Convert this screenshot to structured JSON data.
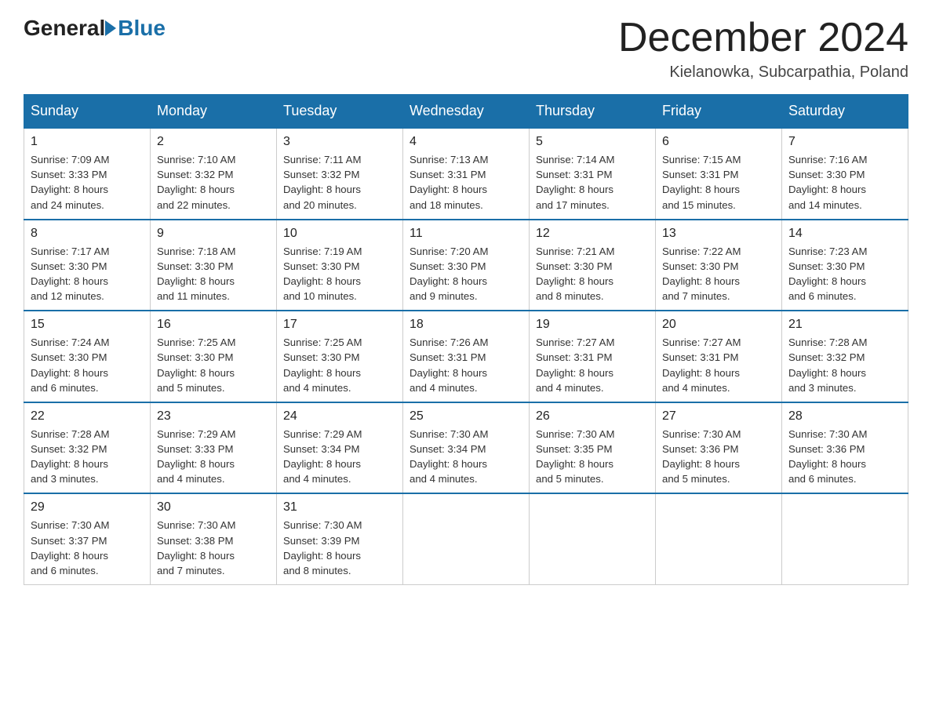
{
  "logo": {
    "general": "General",
    "blue": "Blue"
  },
  "title": "December 2024",
  "location": "Kielanowka, Subcarpathia, Poland",
  "days_of_week": [
    "Sunday",
    "Monday",
    "Tuesday",
    "Wednesday",
    "Thursday",
    "Friday",
    "Saturday"
  ],
  "weeks": [
    [
      {
        "day": "1",
        "info": "Sunrise: 7:09 AM\nSunset: 3:33 PM\nDaylight: 8 hours\nand 24 minutes."
      },
      {
        "day": "2",
        "info": "Sunrise: 7:10 AM\nSunset: 3:32 PM\nDaylight: 8 hours\nand 22 minutes."
      },
      {
        "day": "3",
        "info": "Sunrise: 7:11 AM\nSunset: 3:32 PM\nDaylight: 8 hours\nand 20 minutes."
      },
      {
        "day": "4",
        "info": "Sunrise: 7:13 AM\nSunset: 3:31 PM\nDaylight: 8 hours\nand 18 minutes."
      },
      {
        "day": "5",
        "info": "Sunrise: 7:14 AM\nSunset: 3:31 PM\nDaylight: 8 hours\nand 17 minutes."
      },
      {
        "day": "6",
        "info": "Sunrise: 7:15 AM\nSunset: 3:31 PM\nDaylight: 8 hours\nand 15 minutes."
      },
      {
        "day": "7",
        "info": "Sunrise: 7:16 AM\nSunset: 3:30 PM\nDaylight: 8 hours\nand 14 minutes."
      }
    ],
    [
      {
        "day": "8",
        "info": "Sunrise: 7:17 AM\nSunset: 3:30 PM\nDaylight: 8 hours\nand 12 minutes."
      },
      {
        "day": "9",
        "info": "Sunrise: 7:18 AM\nSunset: 3:30 PM\nDaylight: 8 hours\nand 11 minutes."
      },
      {
        "day": "10",
        "info": "Sunrise: 7:19 AM\nSunset: 3:30 PM\nDaylight: 8 hours\nand 10 minutes."
      },
      {
        "day": "11",
        "info": "Sunrise: 7:20 AM\nSunset: 3:30 PM\nDaylight: 8 hours\nand 9 minutes."
      },
      {
        "day": "12",
        "info": "Sunrise: 7:21 AM\nSunset: 3:30 PM\nDaylight: 8 hours\nand 8 minutes."
      },
      {
        "day": "13",
        "info": "Sunrise: 7:22 AM\nSunset: 3:30 PM\nDaylight: 8 hours\nand 7 minutes."
      },
      {
        "day": "14",
        "info": "Sunrise: 7:23 AM\nSunset: 3:30 PM\nDaylight: 8 hours\nand 6 minutes."
      }
    ],
    [
      {
        "day": "15",
        "info": "Sunrise: 7:24 AM\nSunset: 3:30 PM\nDaylight: 8 hours\nand 6 minutes."
      },
      {
        "day": "16",
        "info": "Sunrise: 7:25 AM\nSunset: 3:30 PM\nDaylight: 8 hours\nand 5 minutes."
      },
      {
        "day": "17",
        "info": "Sunrise: 7:25 AM\nSunset: 3:30 PM\nDaylight: 8 hours\nand 4 minutes."
      },
      {
        "day": "18",
        "info": "Sunrise: 7:26 AM\nSunset: 3:31 PM\nDaylight: 8 hours\nand 4 minutes."
      },
      {
        "day": "19",
        "info": "Sunrise: 7:27 AM\nSunset: 3:31 PM\nDaylight: 8 hours\nand 4 minutes."
      },
      {
        "day": "20",
        "info": "Sunrise: 7:27 AM\nSunset: 3:31 PM\nDaylight: 8 hours\nand 4 minutes."
      },
      {
        "day": "21",
        "info": "Sunrise: 7:28 AM\nSunset: 3:32 PM\nDaylight: 8 hours\nand 3 minutes."
      }
    ],
    [
      {
        "day": "22",
        "info": "Sunrise: 7:28 AM\nSunset: 3:32 PM\nDaylight: 8 hours\nand 3 minutes."
      },
      {
        "day": "23",
        "info": "Sunrise: 7:29 AM\nSunset: 3:33 PM\nDaylight: 8 hours\nand 4 minutes."
      },
      {
        "day": "24",
        "info": "Sunrise: 7:29 AM\nSunset: 3:34 PM\nDaylight: 8 hours\nand 4 minutes."
      },
      {
        "day": "25",
        "info": "Sunrise: 7:30 AM\nSunset: 3:34 PM\nDaylight: 8 hours\nand 4 minutes."
      },
      {
        "day": "26",
        "info": "Sunrise: 7:30 AM\nSunset: 3:35 PM\nDaylight: 8 hours\nand 5 minutes."
      },
      {
        "day": "27",
        "info": "Sunrise: 7:30 AM\nSunset: 3:36 PM\nDaylight: 8 hours\nand 5 minutes."
      },
      {
        "day": "28",
        "info": "Sunrise: 7:30 AM\nSunset: 3:36 PM\nDaylight: 8 hours\nand 6 minutes."
      }
    ],
    [
      {
        "day": "29",
        "info": "Sunrise: 7:30 AM\nSunset: 3:37 PM\nDaylight: 8 hours\nand 6 minutes."
      },
      {
        "day": "30",
        "info": "Sunrise: 7:30 AM\nSunset: 3:38 PM\nDaylight: 8 hours\nand 7 minutes."
      },
      {
        "day": "31",
        "info": "Sunrise: 7:30 AM\nSunset: 3:39 PM\nDaylight: 8 hours\nand 8 minutes."
      },
      {
        "day": "",
        "info": ""
      },
      {
        "day": "",
        "info": ""
      },
      {
        "day": "",
        "info": ""
      },
      {
        "day": "",
        "info": ""
      }
    ]
  ]
}
